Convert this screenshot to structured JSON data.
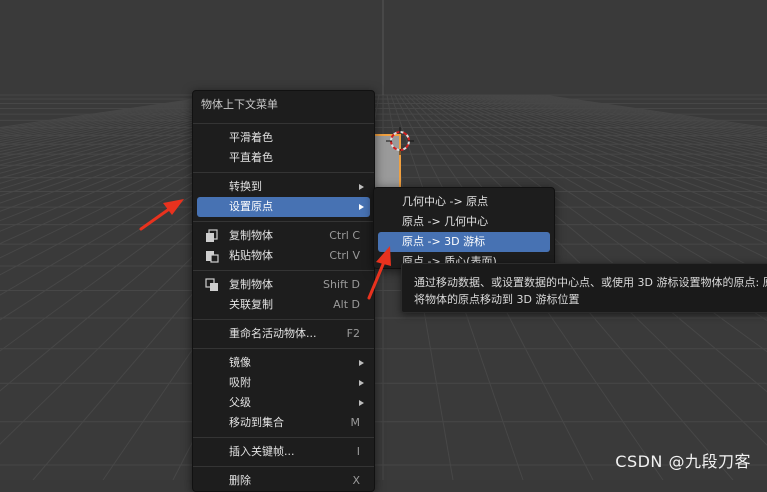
{
  "context_menu": {
    "title": "物体上下文菜单",
    "items": [
      {
        "label": "平滑着色",
        "shortcut": ""
      },
      {
        "label": "平直着色",
        "shortcut": ""
      },
      {
        "label": "转换到",
        "shortcut": "",
        "submenu": true
      },
      {
        "label": "设置原点",
        "shortcut": "",
        "submenu": true,
        "active": true
      },
      {
        "label": "复制物体",
        "shortcut": "Ctrl C",
        "icon": "copy-icon"
      },
      {
        "label": "粘贴物体",
        "shortcut": "Ctrl V",
        "icon": "paste-icon"
      },
      {
        "label": "复制物体",
        "shortcut": "Shift D",
        "icon": "duplicate-icon"
      },
      {
        "label": "关联复制",
        "shortcut": "Alt D"
      },
      {
        "label": "重命名活动物体...",
        "shortcut": "F2"
      },
      {
        "label": "镜像",
        "shortcut": "",
        "submenu": true
      },
      {
        "label": "吸附",
        "shortcut": "",
        "submenu": true
      },
      {
        "label": "父级",
        "shortcut": "",
        "submenu": true
      },
      {
        "label": "移动到集合",
        "shortcut": "M"
      },
      {
        "label": "插入关键帧...",
        "shortcut": "I"
      },
      {
        "label": "删除",
        "shortcut": "X"
      }
    ]
  },
  "submenu": {
    "items": [
      {
        "label": "几何中心 -> 原点"
      },
      {
        "label": "原点 -> 几何中心"
      },
      {
        "label": "原点 -> 3D 游标",
        "active": true
      },
      {
        "label": "原点 -> 质心(表面)"
      }
    ]
  },
  "tooltip": {
    "line1": "通过移动数据、或设置数据的中心点、或使用 3D 游标设置物体的原点: 原",
    "line2": "将物体的原点移动到 3D 游标位置"
  },
  "watermark": "CSDN @九段刀客",
  "colors": {
    "accent": "#4772b3",
    "annotation_arrow": "#e8321e",
    "selection_outline": "#f0a040"
  }
}
